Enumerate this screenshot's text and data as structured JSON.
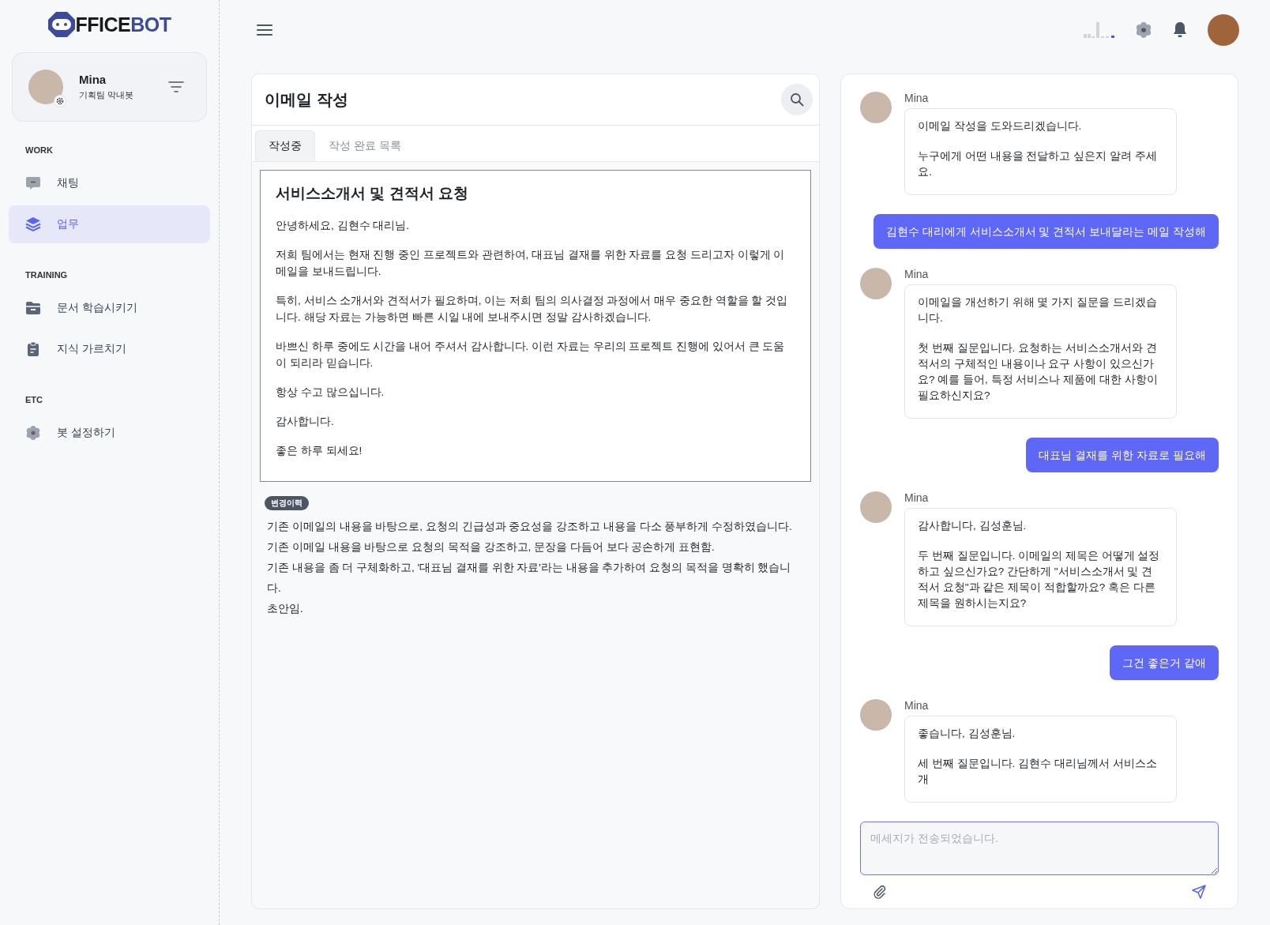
{
  "logo": {
    "dark": "FFICE",
    "accent": "BOT"
  },
  "profile": {
    "name": "Mina",
    "role": "기획팀 막내봇"
  },
  "sidebar": {
    "sections": [
      {
        "title": "WORK",
        "items": [
          {
            "label": "채팅",
            "kind": "chat",
            "selected": false
          },
          {
            "label": "업무",
            "kind": "layers",
            "selected": true
          }
        ]
      },
      {
        "title": "TRAINING",
        "items": [
          {
            "label": "문서 학습시키기",
            "kind": "folder",
            "selected": false
          },
          {
            "label": "지식 가르치기",
            "kind": "clipboard",
            "selected": false
          }
        ]
      },
      {
        "title": "ETC",
        "items": [
          {
            "label": "봇 설정하기",
            "kind": "gear",
            "selected": false
          }
        ]
      }
    ]
  },
  "editor": {
    "title": "이메일 작성",
    "tabs": [
      {
        "label": "작성중",
        "selected": true
      },
      {
        "label": "작성 완료 목록",
        "selected": false
      }
    ],
    "email": {
      "subject": "서비스소개서 및 견적서 요청",
      "paragraphs": [
        "안녕하세요, 김현수 대리님.",
        "저희 팀에서는 현재 진행 중인 프로젝트와 관련하여, 대표님 결재를 위한 자료를 요청 드리고자 이렇게 이메일을 보내드립니다.",
        "특히, 서비스 소개서와 견적서가 필요하며, 이는 저희 팀의 의사결정 과정에서 매우 중요한 역할을 할 것입니다. 해당 자료는 가능하면 빠른 시일 내에 보내주시면 정말 감사하겠습니다.",
        "바쁘신 하루 중에도 시간을 내어 주셔서 감사합니다. 이런 자료는 우리의 프로젝트 진행에 있어서 큰 도움이 되리라 믿습니다.",
        "항상 수고 많으십니다.",
        "감사합니다.",
        "좋은 하루 되세요!"
      ]
    },
    "history": {
      "badge": "변경이력",
      "entries": [
        "기존 이메일의 내용을 바탕으로, 요청의 긴급성과 중요성을 강조하고 내용을 다소 풍부하게 수정하였습니다.",
        "기존 이메일 내용을 바탕으로 요청의 목적을 강조하고, 문장을 다듬어 보다 공손하게 표현함.",
        "기존 내용을 좀 더 구체화하고, '대표님 결재를 위한 자료'라는 내용을 추가하여 요청의 목적을 명확히 했습니다.",
        "초안임."
      ]
    }
  },
  "chat": {
    "messages": [
      {
        "kind": "bot",
        "author": "Mina",
        "paragraphs": [
          "이메일 작성을 도와드리겠습니다.",
          "누구에게 어떤 내용을 전달하고 싶은지 알려 주세요."
        ]
      },
      {
        "kind": "user",
        "paragraphs": [
          "김현수 대리에게 서비스소개서 및 견적서 보내달라는 메일 작성해"
        ]
      },
      {
        "kind": "bot",
        "author": "Mina",
        "paragraphs": [
          "이메일을 개선하기 위해 몇 가지 질문을 드리겠습니다.",
          "첫 번째 질문입니다. 요청하는 서비스소개서와 견적서의 구체적인 내용이나 요구 사항이 있으신가요? 예를 들어, 특정 서비스나 제품에 대한 사항이 필요하신지요?"
        ]
      },
      {
        "kind": "user",
        "paragraphs": [
          "대표님 결재를 위한 자료로 필요해"
        ]
      },
      {
        "kind": "bot",
        "author": "Mina",
        "paragraphs": [
          "감사합니다, 김성훈님.",
          "두 번째 질문입니다. 이메일의 제목은 어떻게 설정하고 싶으신가요? 간단하게 \"서비스소개서 및 견적서 요청\"과 같은 제목이 적합할까요? 혹은 다른 제목을 원하시는지요?"
        ]
      },
      {
        "kind": "user",
        "paragraphs": [
          "그건 좋은거 같애"
        ]
      },
      {
        "kind": "bot",
        "author": "Mina",
        "paragraphs": [
          "좋습니다, 김성훈님.",
          "세 번째 질문입니다. 김현수 대리님께서 서비스소개"
        ]
      }
    ],
    "input": {
      "placeholder": "메세지가 전송되었습니다."
    }
  }
}
